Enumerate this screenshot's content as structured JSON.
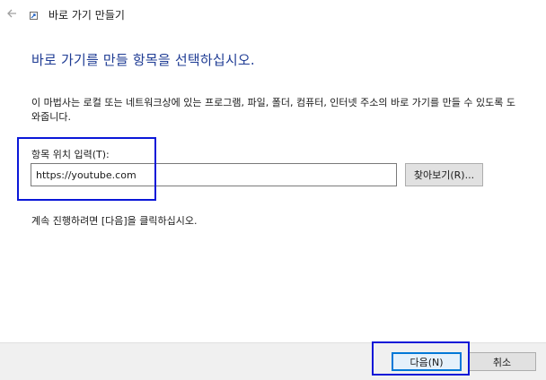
{
  "window": {
    "title": "바로 가기 만들기",
    "back_icon": "back-arrow-icon",
    "app_icon": "shortcut-icon"
  },
  "content": {
    "heading": "바로 가기를 만들 항목을 선택하십시오.",
    "description": "이 마법사는 로컬 또는 네트워크상에 있는 프로그램, 파일, 폴더, 컴퓨터, 인터넷 주소의 바로 가기를 만들 수 있도록 도와줍니다.",
    "location_label": "항목 위치 입력(T):",
    "location_value": "https://youtube.com",
    "browse_label": "찾아보기(R)...",
    "hint": "계속 진행하려면 [다음]을 클릭하십시오."
  },
  "footer": {
    "next_label": "다음(N)",
    "cancel_label": "취소"
  },
  "colors": {
    "heading": "#1f3c94",
    "highlight": "#0a17d8",
    "focus_border": "#0078d7",
    "footer_bg": "#f0f0f0"
  }
}
